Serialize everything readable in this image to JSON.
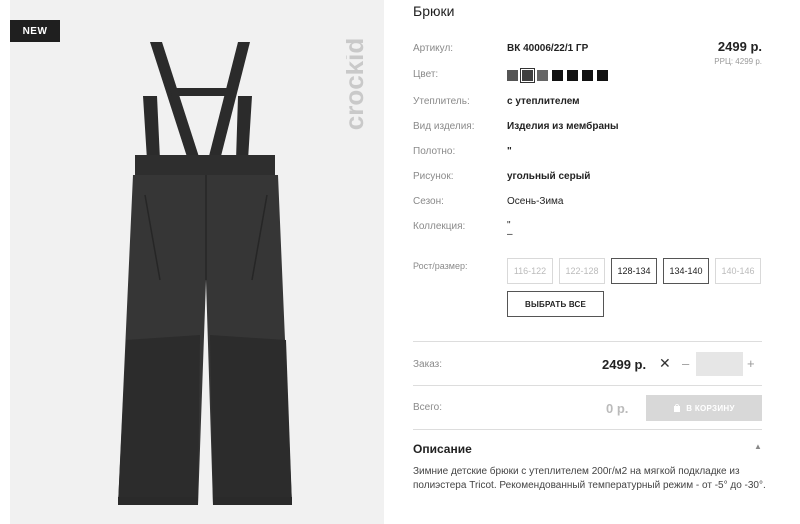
{
  "product": {
    "badge": "NEW",
    "brand_logo_text": "crockid",
    "title": "Брюки",
    "price": "2499 р.",
    "rrp": "РРЦ: 4299 р."
  },
  "attributes": [
    {
      "label": "Артикул:",
      "value": "ВК 40006/22/1 ГР"
    },
    {
      "label": "Цвет:",
      "value": ""
    },
    {
      "label": "Утеплитель:",
      "value": "с утеплителем"
    },
    {
      "label": "Вид изделия:",
      "value": "Изделия из мембраны"
    },
    {
      "label": "Полотно:",
      "value": "\""
    },
    {
      "label": "Рисунок:",
      "value": "угольный серый"
    },
    {
      "label": "Сезон:",
      "value": "Осень-Зима"
    },
    {
      "label": "Коллекция:",
      "value": "\"\n–"
    }
  ],
  "colors": {
    "swatches": [
      "#555555",
      "#3f3f3f",
      "#666666",
      "#111111",
      "#111111",
      "#111111",
      "#111111"
    ],
    "selected_index": 1
  },
  "sizes": {
    "label": "Рост/размер:",
    "options": [
      {
        "label": "116-122",
        "available": false
      },
      {
        "label": "122-128",
        "available": false
      },
      {
        "label": "128-134",
        "available": true
      },
      {
        "label": "134-140",
        "available": true
      },
      {
        "label": "140-146",
        "available": false
      }
    ],
    "select_all_label": "ВЫБРАТЬ ВСЕ"
  },
  "order": {
    "label": "Заказ:",
    "price": "2499 р.",
    "remove_symbol": "✕",
    "minus": "–",
    "plus": "+",
    "quantity": ""
  },
  "total": {
    "label": "Всего:",
    "value": "0 р.",
    "cart_button": "В КОРЗИНУ"
  },
  "description": {
    "heading": "Описание",
    "text": "Зимние детские брюки с утеплителем 200г/м2 на мягкой подкладке из полиэстера Tricot. Рекомендованный температурный режим - от -5° до -30°."
  }
}
